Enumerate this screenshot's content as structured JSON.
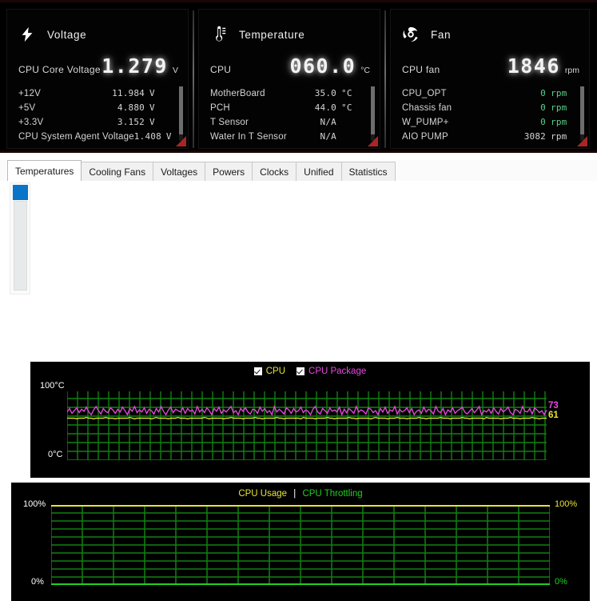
{
  "monitor": {
    "panels": [
      {
        "id": "voltage",
        "icon": "lightning-bolt-icon",
        "title": "Voltage",
        "primary": {
          "label": "CPU Core Voltage",
          "value": "1.279",
          "unit": "V"
        },
        "rows": [
          {
            "name": "+12V",
            "value": "11.984",
            "unit": "V"
          },
          {
            "name": "+5V",
            "value": "4.880",
            "unit": "V"
          },
          {
            "name": "+3.3V",
            "value": "3.152",
            "unit": "V"
          },
          {
            "name": "CPU System Agent Voltage",
            "value": "1.408",
            "unit": "V"
          }
        ]
      },
      {
        "id": "temperature",
        "icon": "thermometer-icon",
        "title": "Temperature",
        "primary": {
          "label": "CPU",
          "value": "060.0",
          "unit": "°C"
        },
        "rows": [
          {
            "name": "MotherBoard",
            "value": "35.0",
            "unit": "°C"
          },
          {
            "name": "PCH",
            "value": "44.0",
            "unit": "°C"
          },
          {
            "name": "T Sensor",
            "value": "N/A",
            "unit": ""
          },
          {
            "name": "Water In T Sensor",
            "value": "N/A",
            "unit": ""
          }
        ]
      },
      {
        "id": "fan",
        "icon": "fan-icon",
        "title": "Fan",
        "primary": {
          "label": "CPU fan",
          "value": "1846",
          "unit": "rpm"
        },
        "rows": [
          {
            "name": "CPU_OPT",
            "value": "0",
            "unit": "rpm",
            "color": "#5ad18a"
          },
          {
            "name": "Chassis fan",
            "value": "0",
            "unit": "rpm",
            "color": "#5ad18a"
          },
          {
            "name": "W_PUMP+",
            "value": "0",
            "unit": "rpm",
            "color": "#5ad18a"
          },
          {
            "name": "AIO PUMP",
            "value": "3082",
            "unit": "rpm",
            "color": "#d4d4d4"
          }
        ]
      }
    ]
  },
  "tabs": [
    {
      "label": "Temperatures",
      "active": true
    },
    {
      "label": "Cooling Fans",
      "active": false
    },
    {
      "label": "Voltages",
      "active": false
    },
    {
      "label": "Powers",
      "active": false
    },
    {
      "label": "Clocks",
      "active": false
    },
    {
      "label": "Unified",
      "active": false
    },
    {
      "label": "Statistics",
      "active": false
    }
  ],
  "colors": {
    "grid": "#128012",
    "cpu": "#e8e432",
    "cpu_package": "#e84ae0",
    "throttling": "#20d020",
    "accent_blue": "#0a74c8",
    "corner_red": "#a82626"
  },
  "chart_data": [
    {
      "type": "line",
      "id": "temperatures-chart",
      "title": "",
      "ylabel_top": "100°C",
      "ylabel_bottom": "0°C",
      "ylim": [
        0,
        100
      ],
      "grid": true,
      "legend_position": "top-center",
      "legend": [
        {
          "label": "CPU",
          "color": "#e8e432",
          "checked": true
        },
        {
          "label": "CPU Package",
          "color": "#e84ae0",
          "checked": true
        }
      ],
      "annotations": [
        {
          "text": "73",
          "color": "#e84ae0"
        },
        {
          "text": "61",
          "color": "#e8e432"
        }
      ],
      "series": [
        {
          "name": "CPU Package",
          "color": "#e84ae0",
          "current": 73,
          "values": [
            70,
            75,
            68,
            72,
            76,
            69,
            74,
            71,
            77,
            70,
            66,
            73,
            78,
            72,
            67,
            75,
            71,
            69,
            76,
            73,
            68,
            74,
            70,
            77,
            72,
            66,
            75,
            71,
            78,
            69,
            73,
            70,
            76,
            68,
            74,
            72,
            67,
            75,
            70,
            78,
            71,
            66,
            73,
            77,
            69,
            74,
            72,
            70,
            76,
            68,
            75,
            71,
            73,
            67,
            78,
            70,
            74,
            69,
            76,
            72,
            66,
            75,
            71,
            77,
            68,
            73,
            70,
            74,
            78,
            69,
            72,
            66,
            75,
            71,
            76,
            70,
            67,
            74,
            73,
            68,
            77,
            71,
            75,
            69,
            72,
            66,
            78,
            70,
            74,
            71,
            67,
            76,
            73,
            68,
            75,
            70,
            72,
            77,
            69,
            73,
            71,
            66,
            74,
            78,
            70,
            67,
            75,
            72,
            68,
            76,
            71,
            73,
            70,
            77,
            66,
            74,
            69,
            75,
            72,
            68,
            78,
            70,
            73,
            71,
            67,
            76,
            74,
            69,
            72,
            66,
            75,
            70,
            77,
            68,
            73,
            71,
            78,
            67,
            74,
            70,
            72,
            76,
            69,
            75,
            66,
            71,
            73,
            68,
            77,
            70,
            74,
            72,
            67,
            78,
            71,
            69,
            75,
            66,
            73,
            70,
            76,
            68,
            72,
            74,
            77,
            70,
            67,
            71,
            75,
            69,
            73,
            78,
            66,
            72,
            70,
            74,
            68,
            76,
            71,
            67,
            75,
            70,
            73,
            77,
            69,
            66,
            74,
            72,
            68,
            78,
            71,
            70,
            75,
            67,
            76,
            73,
            69,
            72,
            66,
            73
          ]
        },
        {
          "name": "CPU",
          "color": "#e8e432",
          "current": 61,
          "values": [
            61,
            61,
            61,
            61,
            60,
            61,
            61,
            61,
            62,
            61,
            61,
            60,
            61,
            61,
            61,
            61,
            62,
            61,
            61,
            61,
            60,
            61,
            61,
            61,
            61,
            61,
            62,
            61,
            60,
            61,
            61,
            61,
            61,
            61,
            61,
            60,
            61,
            62,
            61,
            61,
            61,
            61,
            60,
            61,
            61,
            61,
            62,
            61,
            61,
            61,
            60,
            61,
            61,
            61,
            61,
            61,
            61,
            62,
            61,
            60,
            61,
            61,
            61,
            61,
            61,
            60,
            61,
            61,
            62,
            61,
            61,
            61,
            61,
            60,
            61,
            61,
            61,
            61,
            62,
            61,
            61,
            60,
            61,
            61,
            61,
            61,
            61,
            62,
            61,
            61,
            60,
            61,
            61,
            61,
            61,
            61,
            61,
            60,
            62,
            61,
            61,
            61,
            61,
            60,
            61,
            61,
            61,
            61,
            62,
            61,
            61,
            60,
            61,
            61,
            61,
            61,
            61,
            62,
            61,
            61,
            60,
            61,
            61,
            61,
            61,
            61,
            60,
            61,
            62,
            61,
            61,
            61,
            61,
            60,
            61,
            61,
            61,
            62,
            61,
            61,
            61,
            60,
            61,
            61,
            61,
            61,
            62,
            61,
            61,
            60,
            61,
            61,
            61,
            61,
            61,
            62,
            61,
            61,
            61,
            60,
            61,
            61,
            61,
            61,
            62,
            61,
            61,
            60,
            61,
            61,
            61,
            61,
            61,
            60,
            62,
            61,
            61,
            61,
            61,
            61,
            60,
            61,
            61,
            61,
            62,
            61,
            61,
            61,
            60,
            61,
            61,
            61,
            61,
            62,
            61,
            61,
            60,
            61,
            61,
            61
          ]
        }
      ]
    },
    {
      "type": "line",
      "id": "cpu-usage-chart",
      "title_parts": [
        {
          "text": "CPU Usage",
          "color": "#e8e432"
        },
        {
          "text": "|",
          "color": "#ffffff"
        },
        {
          "text": "CPU Throttling",
          "color": "#20d020"
        }
      ],
      "ylabel_top_left": "100%",
      "ylabel_bottom_left": "0%",
      "ylabel_top_right": "100%",
      "ylabel_bottom_right": "0%",
      "ylim": [
        0,
        100
      ],
      "grid": true,
      "series": [
        {
          "name": "CPU Usage",
          "color": "#e8e432",
          "constant": 100
        },
        {
          "name": "CPU Throttling",
          "color": "#20d020",
          "constant": 0
        }
      ]
    }
  ]
}
